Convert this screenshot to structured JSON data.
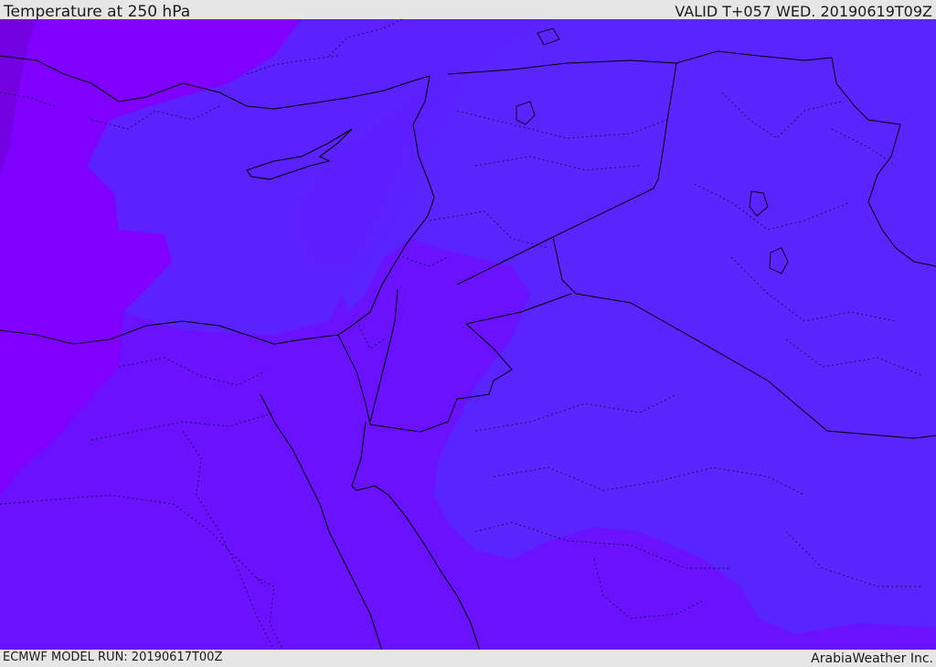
{
  "header": {
    "title": "Temperature at 250 hPa",
    "valid_time": "VALID T+057 WED. 20190619T09Z"
  },
  "footer": {
    "model_run": "ECMWF MODEL RUN: 20190617T00Z",
    "credit": "ArabiaWeather Inc."
  },
  "colors": {
    "band_warm": "#8000ff",
    "band_mid": "#6a12ff",
    "band_cool": "#5b22ff",
    "band_cold": "#5a24fe",
    "corner_dark": "#7300e0",
    "coastline": "#000000",
    "border_dotted": "#111133",
    "chrome": "#e6e6e6"
  }
}
